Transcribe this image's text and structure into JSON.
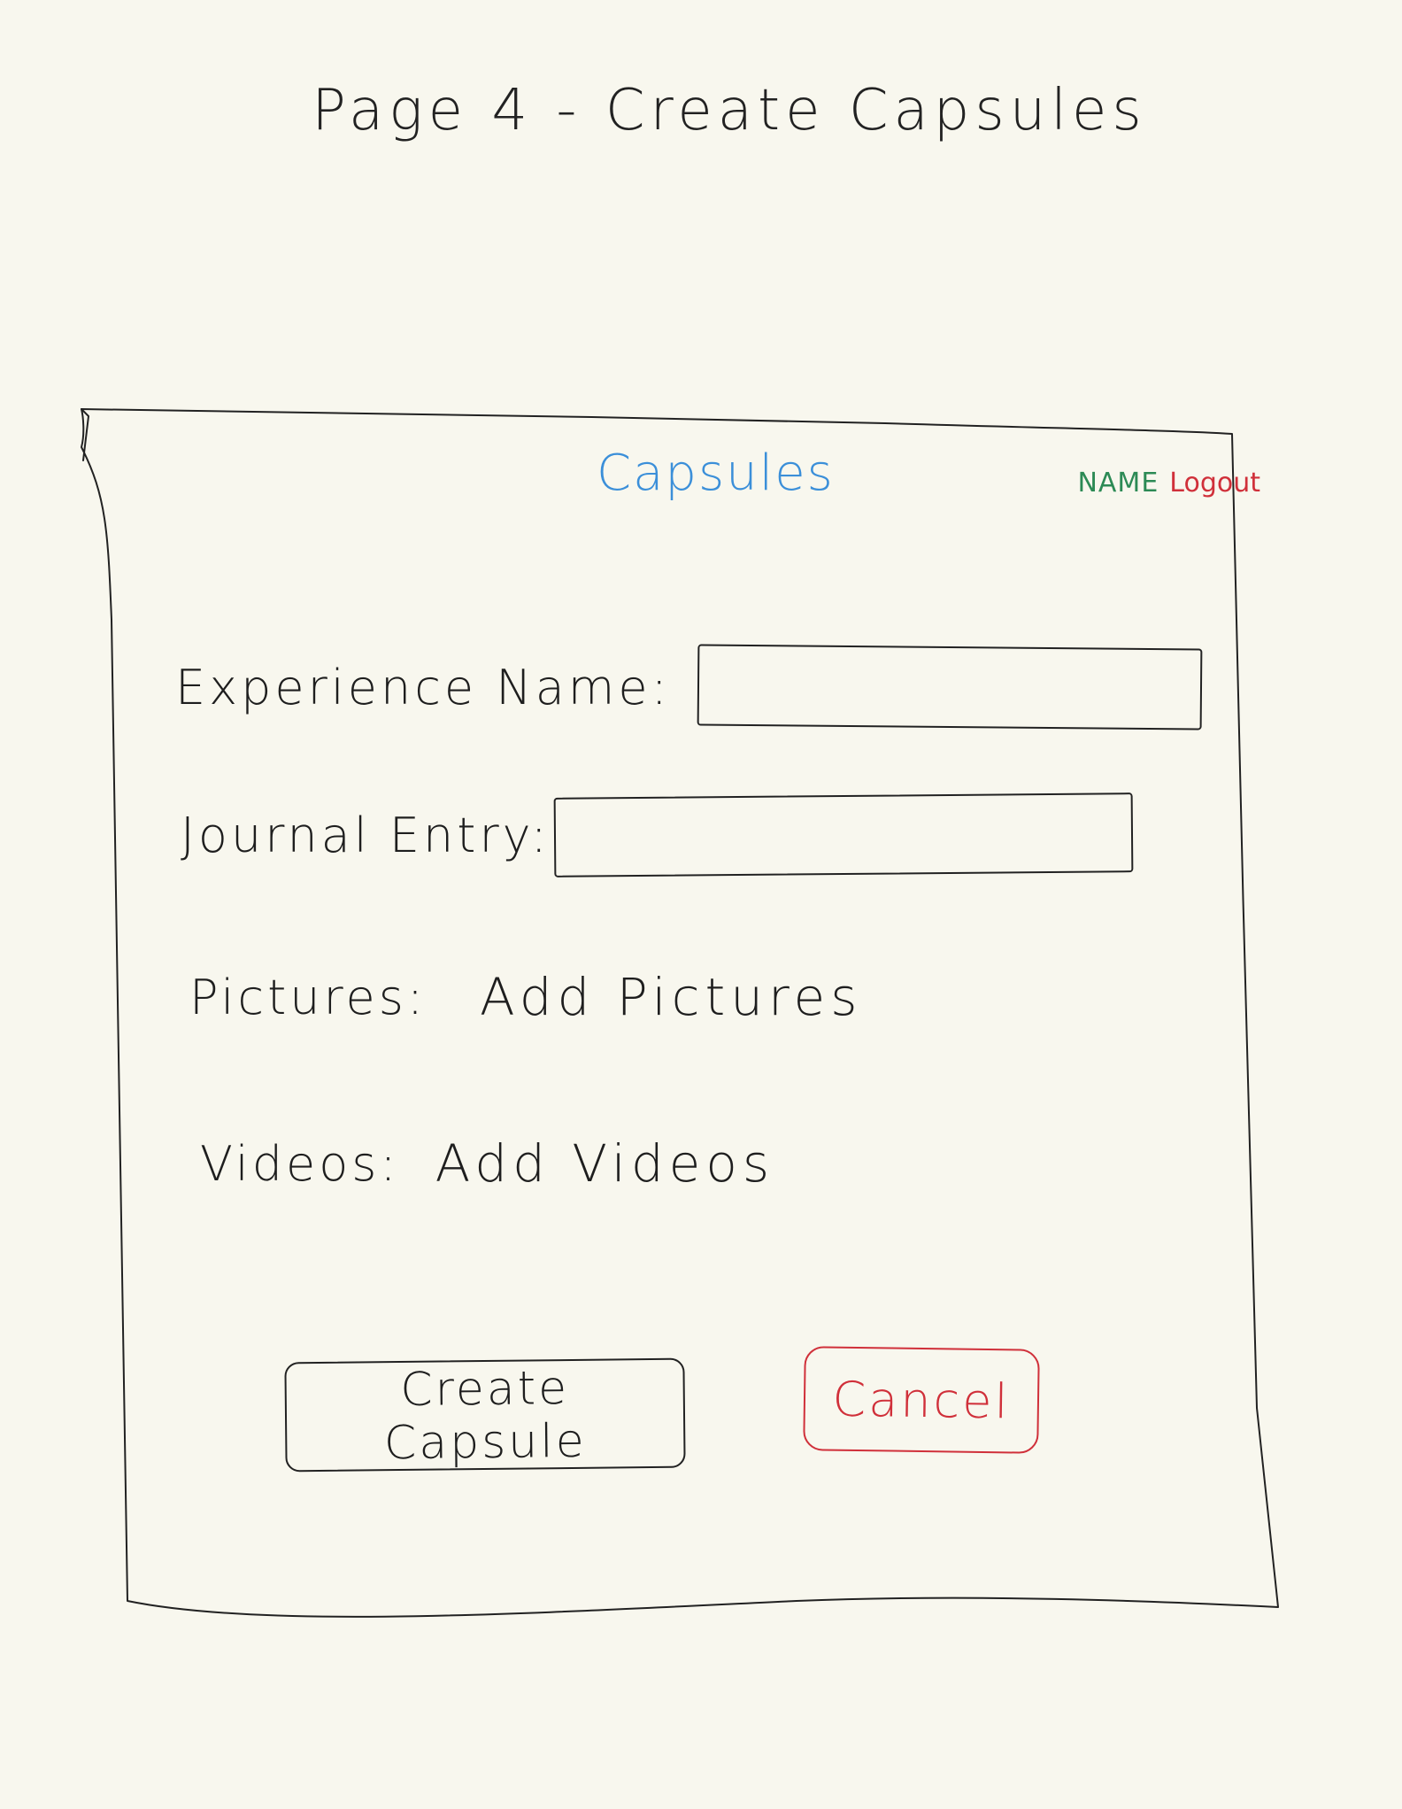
{
  "page": {
    "title": "Page 4 - Create Capsules"
  },
  "header": {
    "brand": "Capsules",
    "user_name": "NAME",
    "logout_label": "Logout"
  },
  "form": {
    "experience_name_label": "Experience Name:",
    "experience_name_value": "",
    "journal_entry_label": "Journal Entry:",
    "journal_entry_value": "",
    "pictures_label": "Pictures:",
    "add_pictures_label": "Add Pictures",
    "videos_label": "Videos:",
    "add_videos_label": "Add Videos",
    "create_button_label": "Create Capsule",
    "cancel_button_label": "Cancel"
  },
  "colors": {
    "background": "#f8f7ee",
    "brand": "#3b8fd9",
    "user_name": "#2c8a55",
    "logout": "#d0303a",
    "cancel": "#d0303a",
    "ink": "#222222"
  }
}
